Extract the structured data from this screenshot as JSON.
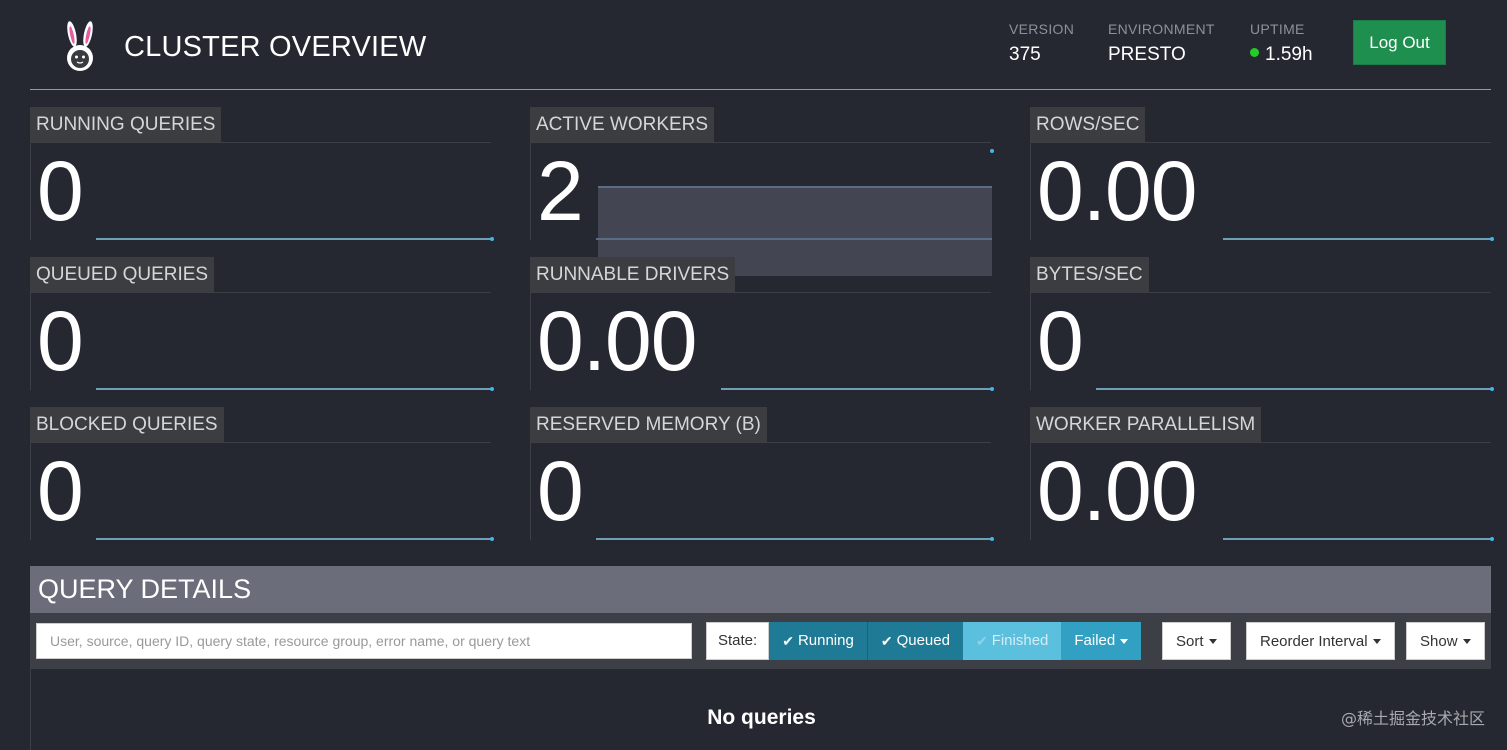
{
  "header": {
    "title": "CLUSTER OVERVIEW",
    "version_label": "VERSION",
    "version_value": "375",
    "environment_label": "ENVIRONMENT",
    "environment_value": "PRESTO",
    "uptime_label": "UPTIME",
    "uptime_value": "1.59h",
    "uptime_status_color": "#25cc28",
    "logout_label": "Log Out",
    "logo_icon": "presto-bunny-logo-icon"
  },
  "stats": [
    {
      "label": "RUNNING QUERIES",
      "value": "0"
    },
    {
      "label": "ACTIVE WORKERS",
      "value": "2"
    },
    {
      "label": "ROWS/SEC",
      "value": "0.00"
    },
    {
      "label": "QUEUED QUERIES",
      "value": "0"
    },
    {
      "label": "RUNNABLE DRIVERS",
      "value": "0.00"
    },
    {
      "label": "BYTES/SEC",
      "value": "0"
    },
    {
      "label": "BLOCKED QUERIES",
      "value": "0"
    },
    {
      "label": "RESERVED MEMORY (B)",
      "value": "0"
    },
    {
      "label": "WORKER PARALLELISM",
      "value": "0.00"
    }
  ],
  "query_details": {
    "title": "QUERY DETAILS",
    "search_placeholder": "User, source, query ID, query state, resource group, error name, or query text",
    "state_label": "State:",
    "states": {
      "running": "Running",
      "queued": "Queued",
      "finished": "Finished",
      "failed": "Failed"
    },
    "sort_label": "Sort",
    "reorder_label": "Reorder Interval",
    "show_label": "Show",
    "empty_message": "No queries"
  },
  "watermark": "@稀土掘金技术社区",
  "colors": {
    "background": "#262831",
    "accent": "#4fb3d9",
    "logout": "#1e8f4e",
    "state_active": "#1f7a96"
  }
}
